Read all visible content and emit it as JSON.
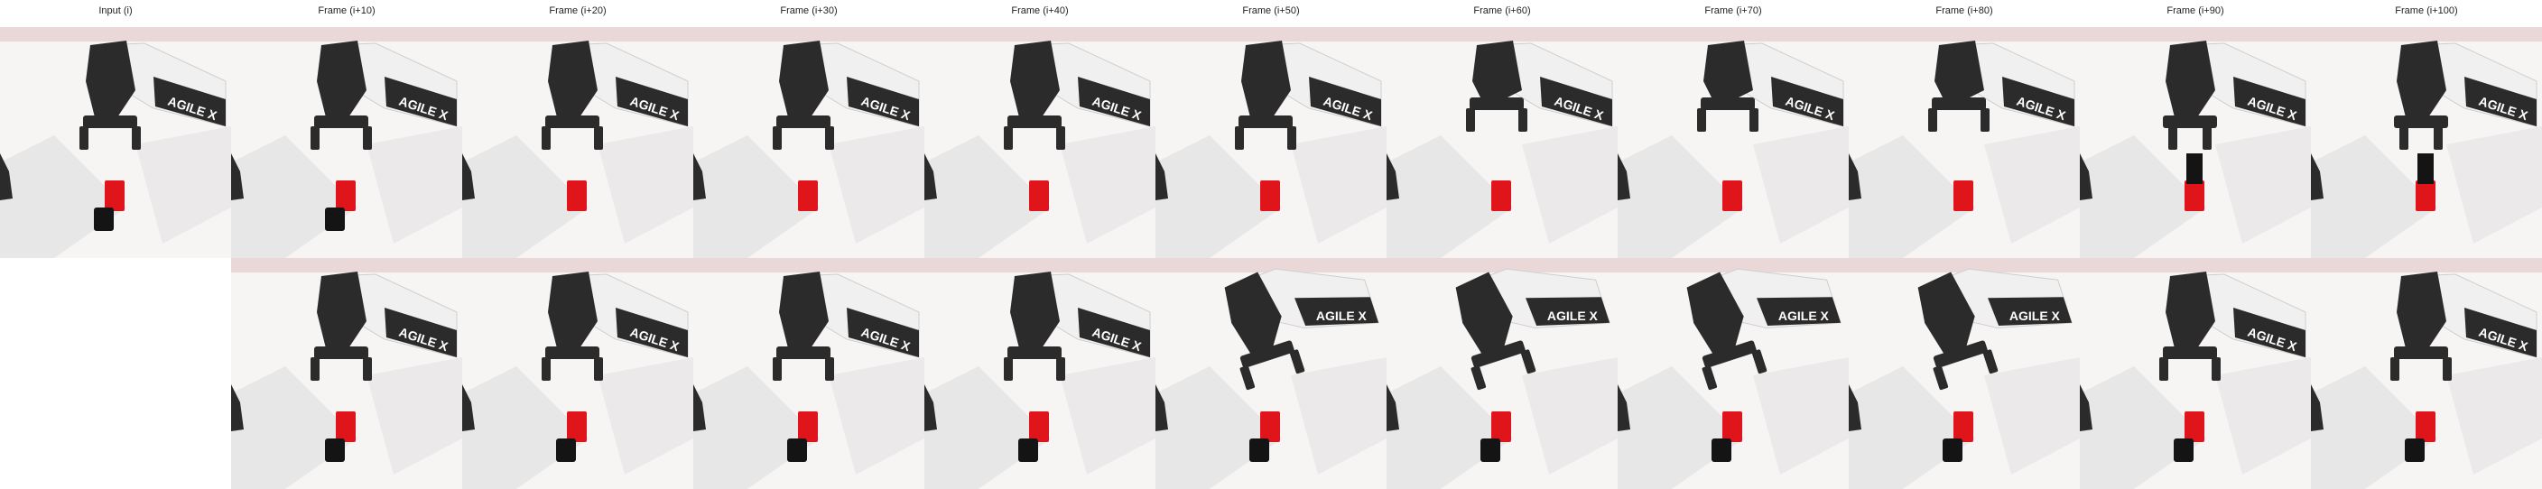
{
  "column_labels": [
    "Input (i)",
    "Frame (i+10)",
    "Frame (i+20)",
    "Frame (i+30)",
    "Frame (i+40)",
    "Frame (i+50)",
    "Frame (i+60)",
    "Frame (i+70)",
    "Frame (i+80)",
    "Frame (i+90)",
    "Frame (i+100)"
  ],
  "arm_logo_text": "AGILE X",
  "colors": {
    "background": "#f7f4f4",
    "wall_band": "#ead8d8",
    "floor_shadow": "#dcdcdc",
    "arm_dark": "#2b2b2b",
    "arm_white": "#f0f0f0",
    "cube_red": "#e0141b",
    "block_black": "#141414",
    "logo_red": "#e0141b"
  },
  "rows": [
    {
      "name": "row-top",
      "frames": [
        {
          "label_index": 0,
          "cube": true,
          "block": true,
          "gripper": "over-cube"
        },
        {
          "label_index": 1,
          "cube": true,
          "block": true,
          "gripper": "over-cube"
        },
        {
          "label_index": 2,
          "cube": true,
          "block": false,
          "gripper": "over-cube"
        },
        {
          "label_index": 3,
          "cube": true,
          "block": false,
          "gripper": "over-cube"
        },
        {
          "label_index": 4,
          "cube": true,
          "block": false,
          "gripper": "over-cube"
        },
        {
          "label_index": 5,
          "cube": true,
          "block": false,
          "gripper": "over-cube"
        },
        {
          "label_index": 6,
          "cube": true,
          "block": false,
          "gripper": "raised"
        },
        {
          "label_index": 7,
          "cube": true,
          "block": false,
          "gripper": "raised"
        },
        {
          "label_index": 8,
          "cube": true,
          "block": false,
          "gripper": "raised"
        },
        {
          "label_index": 9,
          "cube": true,
          "block": false,
          "gripper": "grasping"
        },
        {
          "label_index": 10,
          "cube": true,
          "block": false,
          "gripper": "grasping"
        }
      ]
    },
    {
      "name": "row-bottom",
      "frames": [
        {
          "label_index": 1,
          "cube": true,
          "block": true,
          "gripper": "over-cube"
        },
        {
          "label_index": 2,
          "cube": true,
          "block": true,
          "gripper": "over-cube"
        },
        {
          "label_index": 3,
          "cube": true,
          "block": true,
          "gripper": "over-cube"
        },
        {
          "label_index": 4,
          "cube": true,
          "block": true,
          "gripper": "over-cube"
        },
        {
          "label_index": 5,
          "cube": true,
          "block": true,
          "gripper": "tilted"
        },
        {
          "label_index": 6,
          "cube": true,
          "block": true,
          "gripper": "tilted"
        },
        {
          "label_index": 7,
          "cube": true,
          "block": true,
          "gripper": "tilted"
        },
        {
          "label_index": 8,
          "cube": true,
          "block": true,
          "gripper": "tilted"
        },
        {
          "label_index": 9,
          "cube": true,
          "block": true,
          "gripper": "over-cube"
        },
        {
          "label_index": 10,
          "cube": true,
          "block": true,
          "gripper": "over-cube"
        }
      ]
    }
  ]
}
